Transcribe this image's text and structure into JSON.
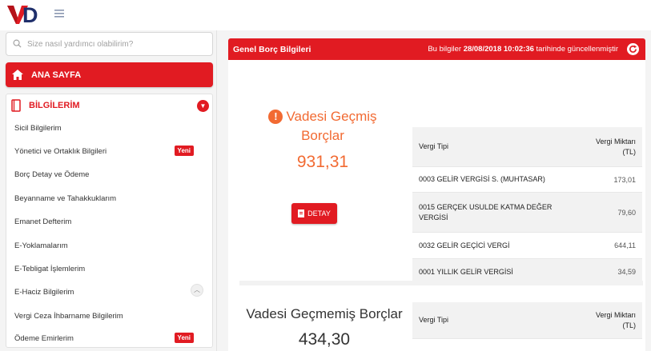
{
  "app": {
    "logo_text": "VD"
  },
  "search": {
    "placeholder": "Size nasıl yardımcı olabilirim?"
  },
  "sidebar": {
    "home_label": "ANA SAYFA",
    "section_title": "BİLGİLERİM",
    "items": [
      {
        "label": "Sicil Bilgilerim",
        "badge": ""
      },
      {
        "label": "Yönetici ve Ortaklık Bilgileri",
        "badge": "Yeni"
      },
      {
        "label": "Borç Detay ve Ödeme",
        "badge": ""
      },
      {
        "label": "Beyanname ve Tahakkuklarım",
        "badge": ""
      },
      {
        "label": "Emanet Defterim",
        "badge": ""
      },
      {
        "label": "E-Yoklamalarım",
        "badge": ""
      },
      {
        "label": "E-Tebligat İşlemlerim",
        "badge": ""
      },
      {
        "label": "E-Haciz Bilgilerim",
        "badge": ""
      },
      {
        "label": "Vergi Ceza İhbarname Bilgilerim",
        "badge": ""
      },
      {
        "label": "Ödeme Emirlerim",
        "badge": "Yeni"
      }
    ]
  },
  "card": {
    "title": "Genel Borç Bilgileri",
    "update_prefix": "Bu bilgiler ",
    "update_date": "28/08/2018 10:02:36",
    "update_suffix": " tarihinde güncellenmiştir"
  },
  "overdue": {
    "label_line1": "Vadesi Geçmiş",
    "label_line2": "Borçlar",
    "amount": "931,31",
    "detail_button": "DETAY"
  },
  "overdue_table": {
    "col_type": "Vergi Tipi",
    "col_amount_line1": "Vergi Miktarı",
    "col_amount_line2": "(TL)",
    "rows": [
      {
        "type": "0003 GELİR VERGİSİ S. (MUHTASAR)",
        "amount": "173,01"
      },
      {
        "type": "0015 GERÇEK USULDE KATMA DEĞER VERGİSİ",
        "amount": "79,60"
      },
      {
        "type": "0032 GELİR GEÇİCİ VERGİ",
        "amount": "644,11"
      },
      {
        "type": "0001 YILLIK GELİR VERGİSİ",
        "amount": "34,59"
      }
    ]
  },
  "notdue": {
    "label": "Vadesi Geçmemiş Borçlar",
    "amount": "434,30"
  },
  "notdue_table": {
    "col_type": "Vergi Tipi",
    "col_amount_line1": "Vergi Miktarı",
    "col_amount_line2": "(TL)"
  },
  "colors": {
    "brand_red": "#e11b22",
    "accent_orange": "#f26a32",
    "logo_navy": "#1f2f6b"
  }
}
